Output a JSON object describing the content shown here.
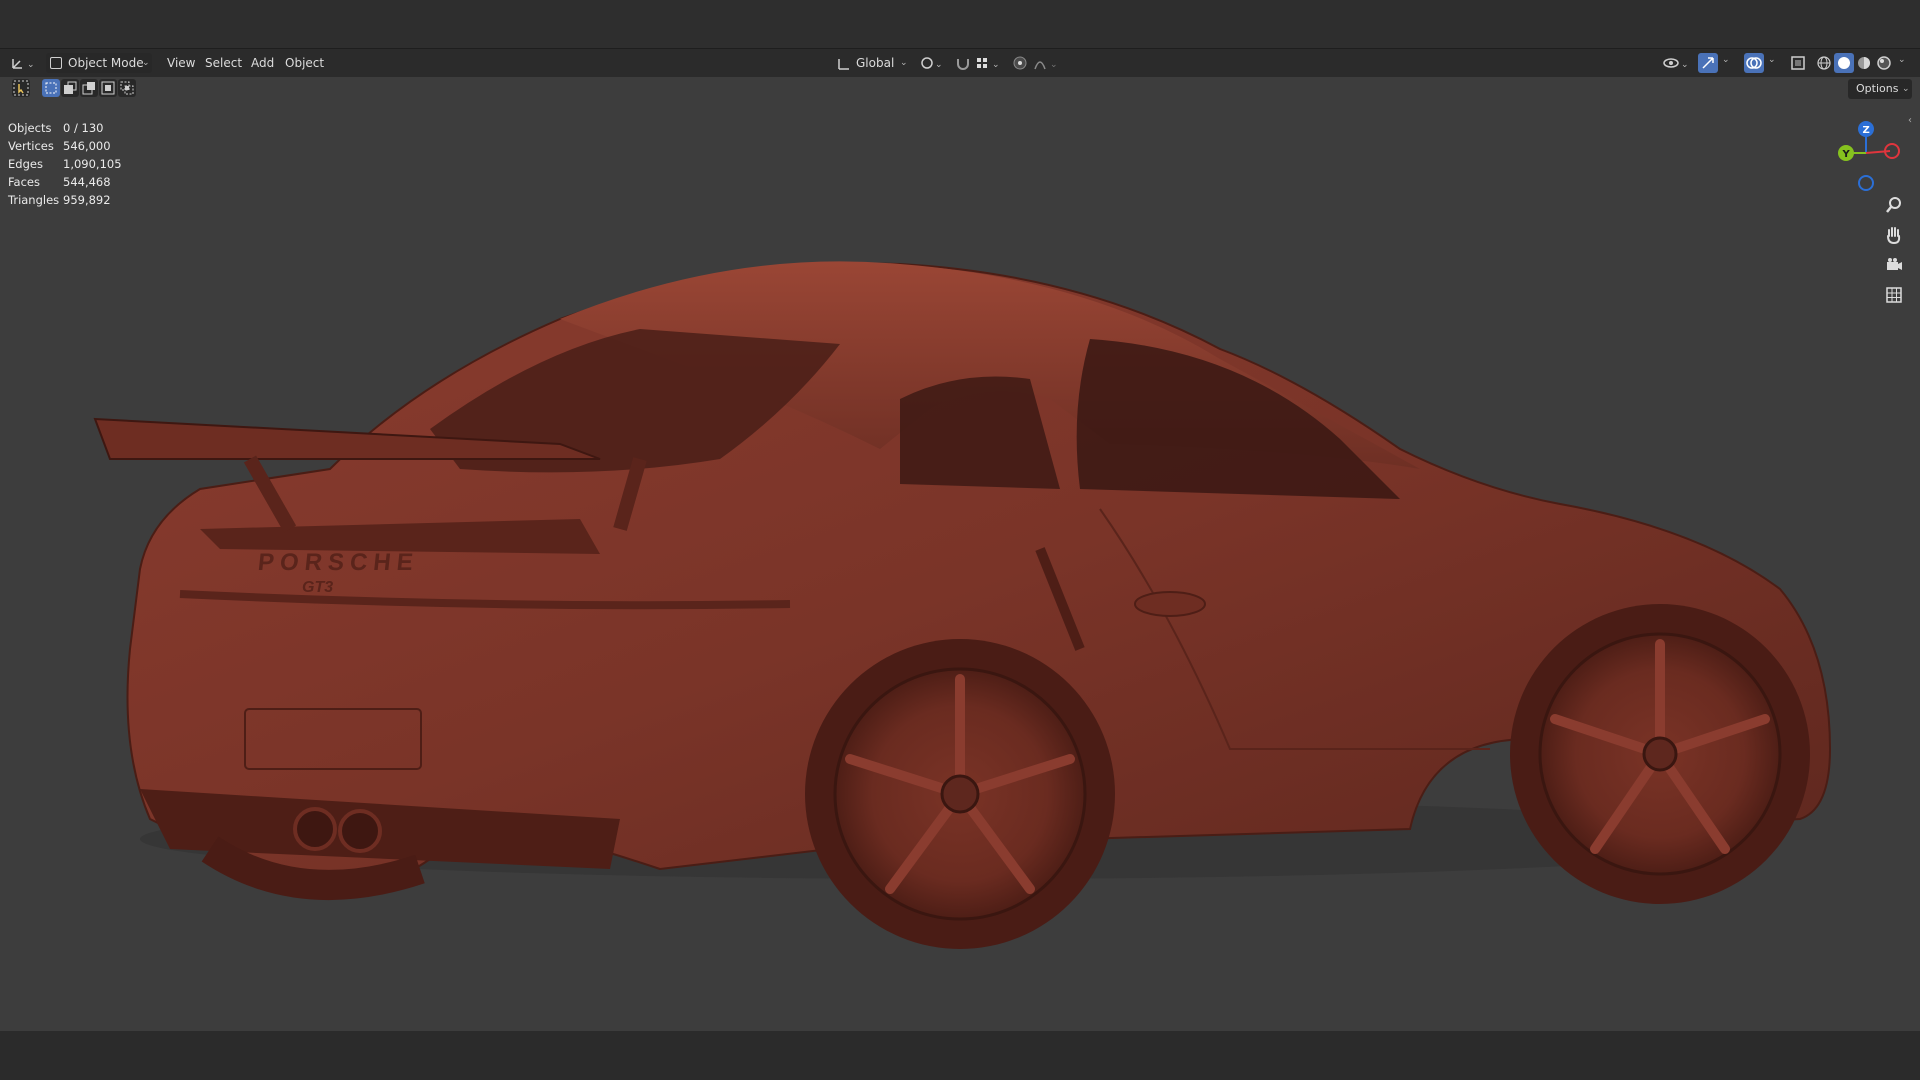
{
  "header": {
    "mode_label": "Object Mode",
    "menus": [
      "View",
      "Select",
      "Add",
      "Object"
    ],
    "orientation_label": "Global",
    "options_label": "Options"
  },
  "stats": [
    {
      "key": "Objects",
      "value": "0 / 130"
    },
    {
      "key": "Vertices",
      "value": "546,000"
    },
    {
      "key": "Edges",
      "value": "1,090,105"
    },
    {
      "key": "Faces",
      "value": "544,468"
    },
    {
      "key": "Triangles",
      "value": "959,892"
    }
  ],
  "gizmo": {
    "z_label": "Z",
    "y_label": "Y",
    "x_color": "#e0353d",
    "y_color": "#86c21f",
    "z_color": "#2b6fd6"
  },
  "model": {
    "brand_text": "PORSCHE",
    "badge_text": "GT3",
    "body_color": "#7a3428"
  },
  "colors": {
    "viewport_bg": "#3d3d3d",
    "header_bg": "#282828",
    "active_blue": "#4a72b8"
  }
}
